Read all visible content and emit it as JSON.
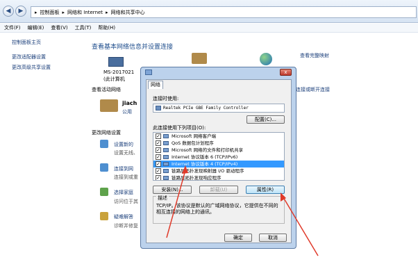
{
  "breadcrumb": {
    "item1": "控制面板",
    "item2": "网络和 Internet",
    "item3": "网络和共享中心"
  },
  "menu": [
    "文件(F)",
    "编辑(E)",
    "查看(V)",
    "工具(T)",
    "帮助(H)"
  ],
  "sidebar": {
    "items": [
      {
        "label": "控制面板主页"
      },
      {
        "label": "更改适配器设置"
      },
      {
        "label": "更改高级共享设置"
      }
    ]
  },
  "main": {
    "title": "查看基本网络信息并设置连接",
    "full_map_link": "查看完整映射",
    "computer_name": "MS-2017021",
    "computer_sub": "(此计算机",
    "active_networks": "查看活动网络",
    "network_name": "jiach",
    "network_type": "公用",
    "connect_link": "连接或断开连接",
    "change_settings": "更改网络设置",
    "tasks": [
      {
        "link": "设置新的",
        "desc": "设置无线、"
      },
      {
        "link": "连接到网",
        "desc": "连接到或重"
      },
      {
        "link": "选择家庭",
        "desc": "访问位于其"
      },
      {
        "link": "疑难解答",
        "desc": "诊断并修复"
      }
    ]
  },
  "dialog": {
    "tab": "网络",
    "connect_using_label": "连接时使用:",
    "adapter": "Realtek PCIe GBE Family Controller",
    "configure_btn": "配置(C)...",
    "items_label": "此连接使用下列项目(O):",
    "items": [
      {
        "label": "Microsoft 网络客户端",
        "checked": true
      },
      {
        "label": "QoS 数据包计划程序",
        "checked": true
      },
      {
        "label": "Microsoft 网络的文件和打印机共享",
        "checked": true
      },
      {
        "label": "Internet 协议版本 6 (TCP/IPv6)",
        "checked": true
      },
      {
        "label": "Internet 协议版本 4 (TCP/IPv4)",
        "checked": true,
        "selected": true
      },
      {
        "label": "链路层拓扑发现映射器 I/O 驱动程序",
        "checked": true
      },
      {
        "label": "链路层拓扑发现响应程序",
        "checked": true
      }
    ],
    "install_btn": "安装(N)...",
    "uninstall_btn": "卸载(U)",
    "properties_btn": "属性(R)",
    "desc_title": "描述",
    "desc_text": "TCP/IP。该协议是默认的广域网络协议，它提供在不同的相互连接的网络上的通讯。",
    "ok_btn": "确定",
    "cancel_btn": "取消",
    "close_label": "x"
  },
  "colors": {
    "annotation_arrow": "#e03a2a",
    "selection": "#3399ff",
    "link": "#1a3e7a"
  }
}
